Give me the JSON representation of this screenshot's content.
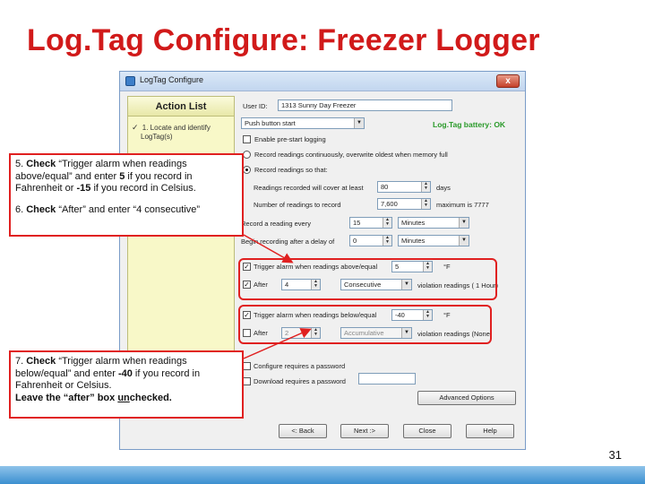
{
  "slide": {
    "title": "Log.Tag Configure: Freezer Logger",
    "page_number": "31",
    "accent_color": "#d11a1a",
    "bar_color": "#3b8fd0"
  },
  "window": {
    "title": "LogTag Configure",
    "close_glyph": "x"
  },
  "action_list": {
    "header": "Action List",
    "item1_check": "✓",
    "item1_line1": "1. Locate and identify",
    "item1_line2": "LogTag(s)"
  },
  "config": {
    "user_id_label": "User ID:",
    "user_id_value": "1313 Sunny Day Freezer",
    "start_mode": "Push button start",
    "battery": "Log.Tag battery: OK",
    "prestart": "Enable pre-start logging",
    "record_overwrite": "Record readings continuously, overwrite oldest when memory full",
    "record_until": "Record readings so that:",
    "cover_label": "Readings recorded will cover at least",
    "cover_value": "80",
    "cover_unit": "days",
    "number_label": "Number of readings to record",
    "number_value": "7,600",
    "number_max": "maximum is 7777",
    "every_label": "Record a reading every",
    "every_value": "15",
    "every_unit": "Minutes",
    "delay_label": "Begin recording after a delay of",
    "delay_value": "0",
    "delay_unit": "Minutes",
    "upper_label": "Trigger alarm when readings above/equal",
    "upper_value": "5",
    "upper_unit": "°F",
    "upper_after_label": "After",
    "upper_after_value": "4",
    "upper_after_type": "Consecutive",
    "upper_violation": "violation readings ( 1 Hour)",
    "lower_label": "Trigger alarm when readings below/equal",
    "lower_value": "-40",
    "lower_unit": "°F",
    "lower_after_label": "After",
    "lower_after_value": "2",
    "lower_after_type": "Accumulative",
    "lower_violation": "violation readings (None)",
    "config_password": "Configure requires a password",
    "download_password": "Download requires a password",
    "advanced_button": "Advanced Options",
    "back_button": "<: Back",
    "next_button": "Next :>",
    "close_button": "Close",
    "help_button": "Help"
  },
  "callouts": {
    "c5_prefix": "5. ",
    "c5_check": "Check",
    "c5_text1": " “Trigger alarm when readings above/equal” and enter ",
    "c5_num1": "5",
    "c5_text2": " if you record in Fahrenheit or ",
    "c5_num2": "-15",
    "c5_text3": " if you record in Celsius.",
    "c6_prefix": "6. ",
    "c6_check": "Check",
    "c6_text": " “After” and enter “4 consecutive”",
    "c7_prefix": "7. ",
    "c7_check": "Check",
    "c7_text1": " “Trigger alarm when readings below/equal” and enter ",
    "c7_num": "-40",
    "c7_text2": " if you record in Fahrenheit or Celsius.",
    "c7_leave1": "Leave the “after” box ",
    "c7_un": "un",
    "c7_leave2": "checked."
  }
}
